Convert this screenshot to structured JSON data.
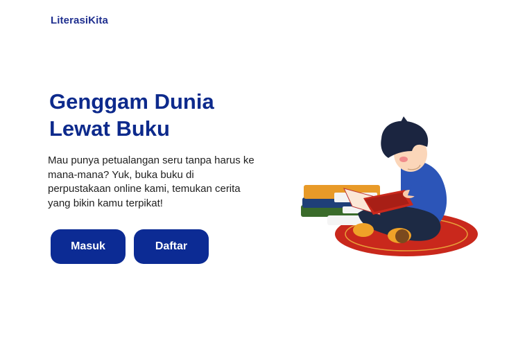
{
  "brand": {
    "name": "LiterasiKita"
  },
  "hero": {
    "title_line1": "Genggam Dunia",
    "title_line2": "Lewat Buku",
    "description": "Mau punya petualangan seru tanpa harus ke mana-mana? Yuk, buka buku di perpustakaan online kami, temukan cerita yang bikin kamu terpikat!"
  },
  "actions": {
    "login_label": "Masuk",
    "register_label": "Daftar"
  },
  "colors": {
    "primary": "#0c2b94",
    "title": "#0d2a8c",
    "background": "#ffffff"
  },
  "illustration": {
    "icon": "child-reading-books-illustration"
  }
}
